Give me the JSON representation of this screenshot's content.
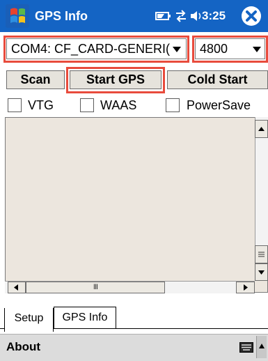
{
  "titlebar": {
    "title": "GPS Info",
    "time": "3:25",
    "color": "#1464c4"
  },
  "port_combo": {
    "value": "COM4:  CF_CARD-GENERI("
  },
  "baud_combo": {
    "value": "4800"
  },
  "buttons": {
    "scan": "Scan",
    "start_gps": "Start GPS",
    "cold_start": "Cold Start"
  },
  "checkboxes": [
    {
      "label": "VTG",
      "checked": false
    },
    {
      "label": "WAAS",
      "checked": false
    },
    {
      "label": "PowerSave",
      "checked": false
    }
  ],
  "hscroll_thumb": "III",
  "tabs": [
    {
      "label": "Setup"
    },
    {
      "label": "GPS Info"
    }
  ],
  "menu": {
    "about": "About"
  },
  "highlight_color": "#e84b3c"
}
